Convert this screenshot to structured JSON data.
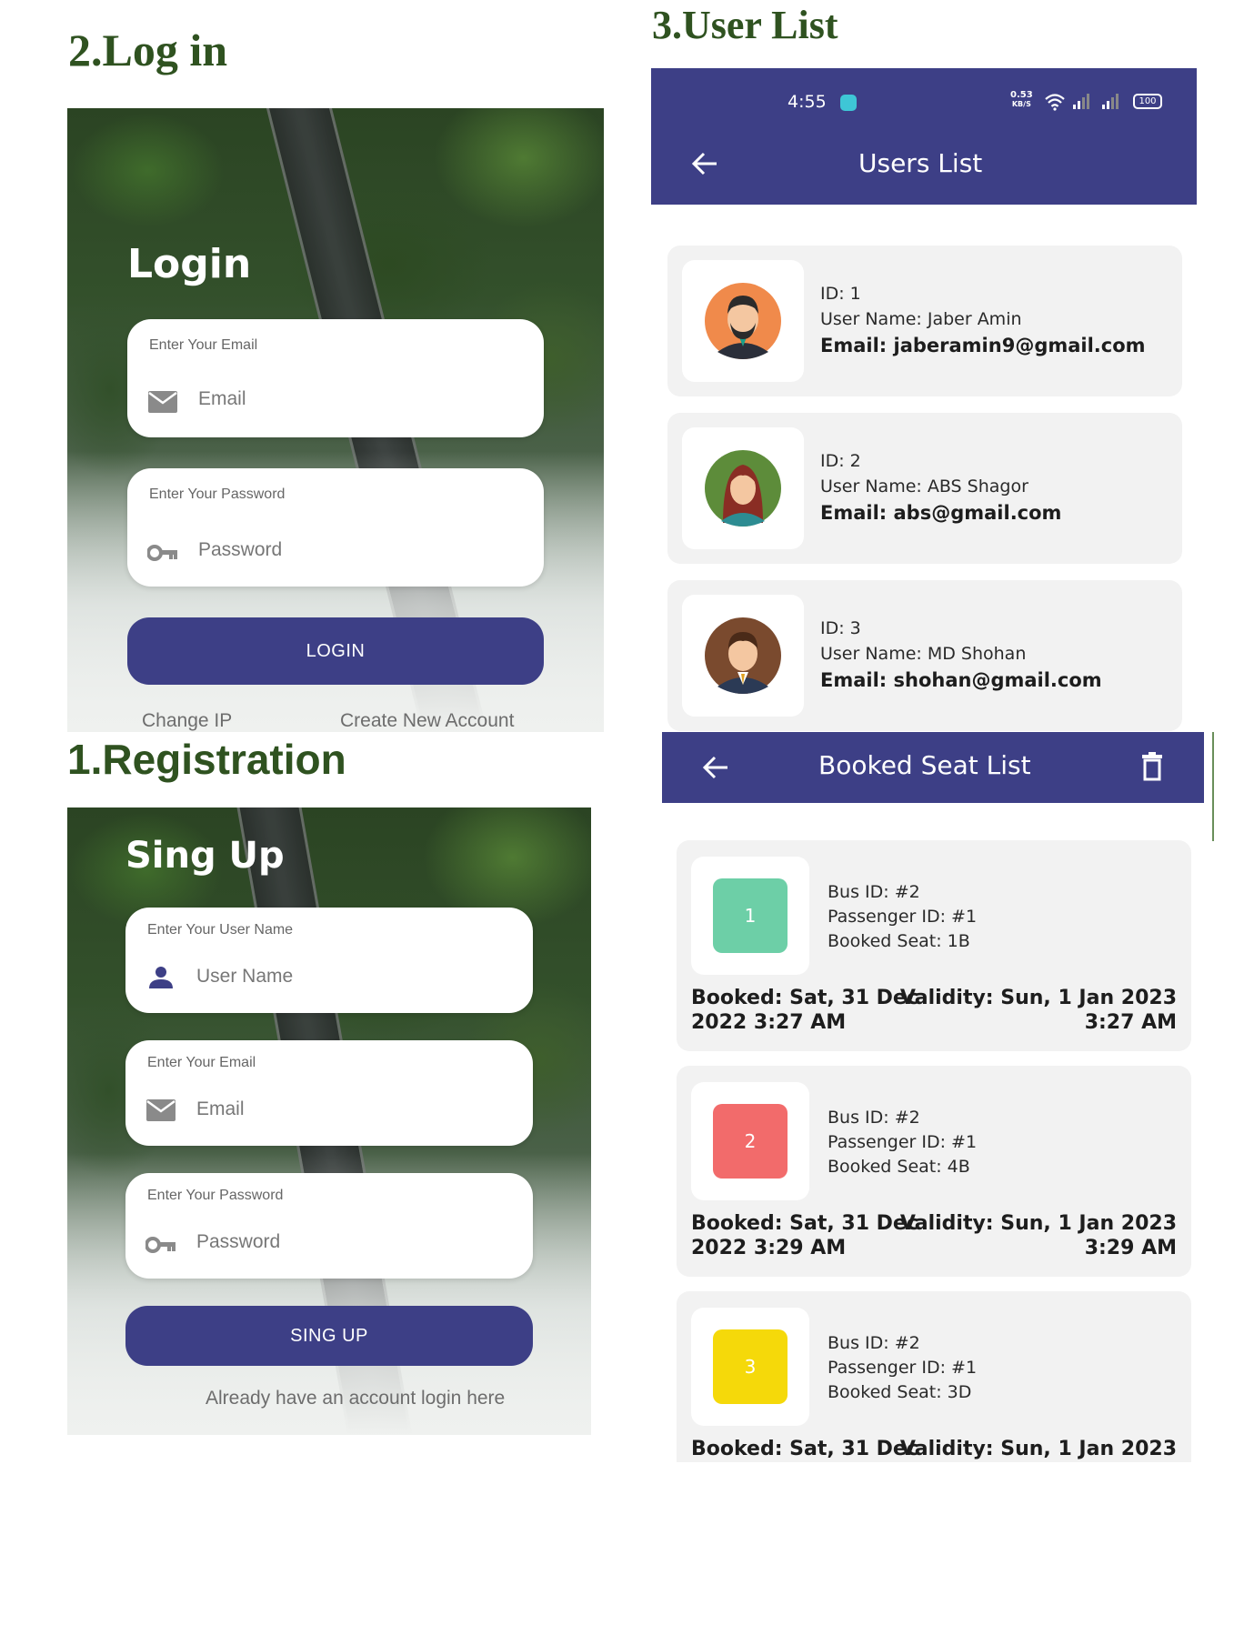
{
  "sections": {
    "login_heading": "2.Log in",
    "registration_heading": "1.Registration",
    "userlist_heading": "3.User List"
  },
  "login": {
    "title": "Login",
    "email_label": "Enter Your Email",
    "email_placeholder": "Email",
    "password_label": "Enter Your Password",
    "password_placeholder": "Password",
    "button": "LOGIN",
    "change_ip": "Change IP",
    "create_account": "Create New Account"
  },
  "signup": {
    "title": "Sing Up",
    "username_label": "Enter Your User Name",
    "username_placeholder": "User Name",
    "email_label": "Enter Your Email",
    "email_placeholder": "Email",
    "password_label": "Enter Your Password",
    "password_placeholder": "Password",
    "button": "SING UP",
    "login_link": "Already have an account login here"
  },
  "status_bar": {
    "time": "4:55",
    "net_speed_top": "0.53",
    "net_speed_unit": "KB/S",
    "battery": "100"
  },
  "users_screen": {
    "title": "Users List",
    "users": [
      {
        "id": "ID: 1",
        "name": "User Name: Jaber Amin",
        "email": "Email: jaberamin9@gmail.com",
        "avatar": "male-beard-avatar",
        "avatar_color": "#f08a4b"
      },
      {
        "id": "ID: 2",
        "name": "User Name: ABS Shagor",
        "email": "Email: abs@gmail.com",
        "avatar": "female-avatar",
        "avatar_color": "#5d8c3a"
      },
      {
        "id": "ID: 3",
        "name": "User Name: MD Shohan",
        "email": "Email: shohan@gmail.com",
        "avatar": "male-suit-avatar",
        "avatar_color": "#7a4a2e"
      }
    ]
  },
  "booked_screen": {
    "title": "Booked Seat List",
    "bookings": [
      {
        "seat_no": "1",
        "color": "#6dcfa7",
        "bus": "Bus ID: #2",
        "passenger": "Passenger ID: #1",
        "seat": "Booked Seat: 1B",
        "booked_l1": "Booked: Sat, 31 Dec",
        "booked_l2": "2022 3:27 AM",
        "valid_l1": "Validity: Sun, 1 Jan 2023",
        "valid_l2": "3:27 AM"
      },
      {
        "seat_no": "2",
        "color": "#f26b6b",
        "bus": "Bus ID: #2",
        "passenger": "Passenger ID: #1",
        "seat": "Booked Seat: 4B",
        "booked_l1": "Booked: Sat, 31 Dec",
        "booked_l2": "2022 3:29 AM",
        "valid_l1": "Validity: Sun, 1 Jan 2023",
        "valid_l2": "3:29 AM"
      },
      {
        "seat_no": "3",
        "color": "#f5d90a",
        "bus": "Bus ID: #2",
        "passenger": "Passenger ID: #1",
        "seat": "Booked Seat: 3D",
        "booked_l1": "Booked: Sat, 31 Dec",
        "booked_l2": "",
        "valid_l1": "Validity: Sun, 1 Jan 2023",
        "valid_l2": ""
      }
    ]
  },
  "colors": {
    "primary": "#3d3f86",
    "heading_green": "#2f5220"
  }
}
